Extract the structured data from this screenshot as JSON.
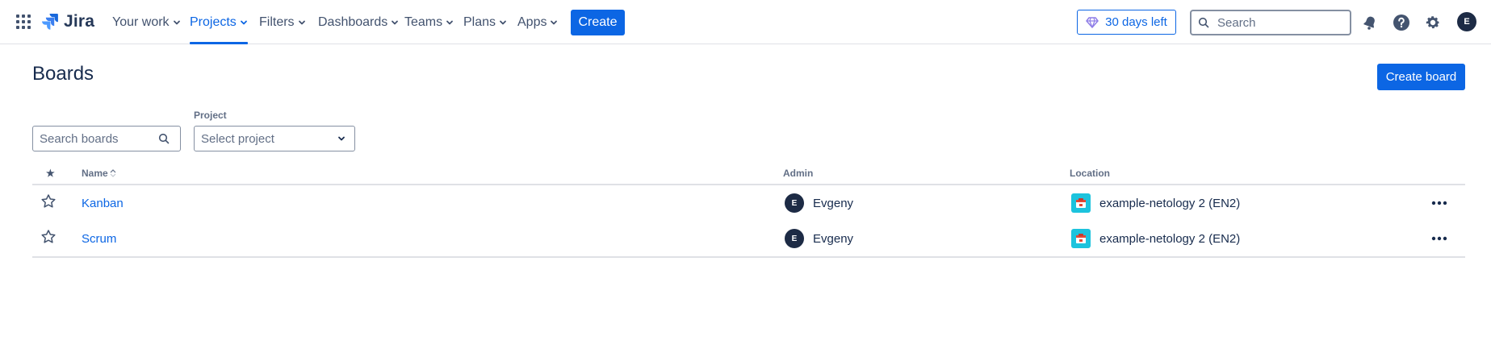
{
  "header": {
    "logo_text": "Jira",
    "nav": [
      {
        "label": "Your work",
        "active": false
      },
      {
        "label": "Projects",
        "active": true
      },
      {
        "label": "Filters",
        "active": false
      },
      {
        "label": "Dashboards",
        "active": false
      },
      {
        "label": "Teams",
        "active": false
      },
      {
        "label": "Plans",
        "active": false
      },
      {
        "label": "Apps",
        "active": false
      }
    ],
    "create_label": "Create",
    "trial_label": "30 days left",
    "search_placeholder": "Search",
    "avatar_initial": "E"
  },
  "page": {
    "title": "Boards",
    "create_board_label": "Create board"
  },
  "filters": {
    "search_placeholder": "Search boards",
    "project_label": "Project",
    "project_placeholder": "Select project"
  },
  "table": {
    "columns": {
      "star": "★",
      "name": "Name",
      "admin": "Admin",
      "location": "Location"
    },
    "rows": [
      {
        "name": "Kanban",
        "admin_initial": "E",
        "admin": "Evgeny",
        "location": "example-netology 2 (EN2)"
      },
      {
        "name": "Scrum",
        "admin_initial": "E",
        "admin": "Evgeny",
        "location": "example-netology 2 (EN2)"
      }
    ]
  },
  "colors": {
    "brand": "#0c66e4",
    "text": "#172b4d",
    "avatar_bg": "#1d2b45",
    "project_icon": "#1cc3dd"
  },
  "icons": {
    "app_switcher": "grid-icon",
    "trial": "gem-icon",
    "search": "search-icon",
    "notifications": "bell-icon",
    "help": "help-icon",
    "settings": "gear-icon",
    "star": "star-outline-icon",
    "more": "more-horizontal-icon"
  }
}
